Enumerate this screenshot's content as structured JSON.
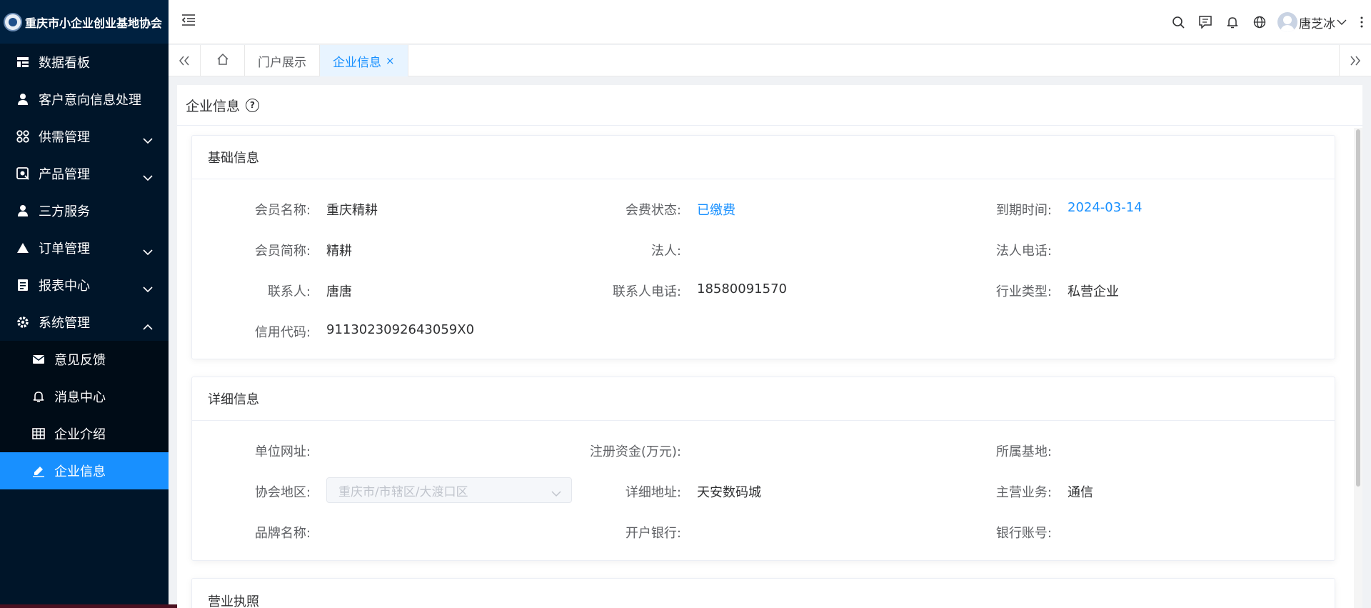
{
  "app": {
    "title": "重庆市小企业创业基地协会"
  },
  "sidebar": {
    "items": [
      {
        "label": "数据看板",
        "icon": "dashboard-icon"
      },
      {
        "label": "客户意向信息处理",
        "icon": "user-icon"
      },
      {
        "label": "供需管理",
        "icon": "grid-icon",
        "expandable": true
      },
      {
        "label": "产品管理",
        "icon": "product-icon",
        "expandable": true
      },
      {
        "label": "三方服务",
        "icon": "user-icon"
      },
      {
        "label": "订单管理",
        "icon": "triangle-icon",
        "expandable": true
      },
      {
        "label": "报表中心",
        "icon": "report-icon",
        "expandable": true
      },
      {
        "label": "系统管理",
        "icon": "gear-icon",
        "expanded": true
      }
    ],
    "subitems": [
      {
        "label": "意见反馈",
        "icon": "mail-icon"
      },
      {
        "label": "消息中心",
        "icon": "bell-icon"
      },
      {
        "label": "企业介绍",
        "icon": "table-icon"
      },
      {
        "label": "企业信息",
        "icon": "edit-icon",
        "active": true
      }
    ]
  },
  "header": {
    "username": "唐芝冰"
  },
  "tabs": [
    {
      "label": "门户展示"
    },
    {
      "label": "企业信息",
      "active": true,
      "close": "×"
    }
  ],
  "page": {
    "title": "企业信息",
    "help": "?"
  },
  "basic": {
    "title": "基础信息",
    "member_name_label": "会员名称:",
    "member_name": "重庆精耕",
    "fee_status_label": "会费状态:",
    "fee_status": "已缴费",
    "expire_label": "到期时间:",
    "expire": "2024-03-14",
    "short_name_label": "会员简称:",
    "short_name": "精耕",
    "legal_label": "法人:",
    "legal": "",
    "legal_phone_label": "法人电话:",
    "legal_phone": "",
    "contact_label": "联系人:",
    "contact": "唐唐",
    "contact_phone_label": "联系人电话:",
    "contact_phone": "18580091570",
    "industry_label": "行业类型:",
    "industry": "私营企业",
    "credit_label": "信用代码:",
    "credit": "9113023092643059X0"
  },
  "detail": {
    "title": "详细信息",
    "website_label": "单位网址:",
    "website": "",
    "capital_label": "注册资金(万元):",
    "capital": "",
    "base_label": "所属基地:",
    "base": "",
    "region_label": "协会地区:",
    "region_placeholder": "重庆市/市辖区/大渡口区",
    "address_label": "详细地址:",
    "address": "天安数码城",
    "business_label": "主营业务:",
    "business": "通信",
    "brand_label": "品牌名称:",
    "brand": "",
    "bank_label": "开户银行:",
    "bank": "",
    "account_label": "银行账号:",
    "account": ""
  },
  "license": {
    "title": "营业执照"
  },
  "colors": {
    "sidebar": "#001529",
    "active": "#1890ff",
    "link": "#1890ff"
  }
}
